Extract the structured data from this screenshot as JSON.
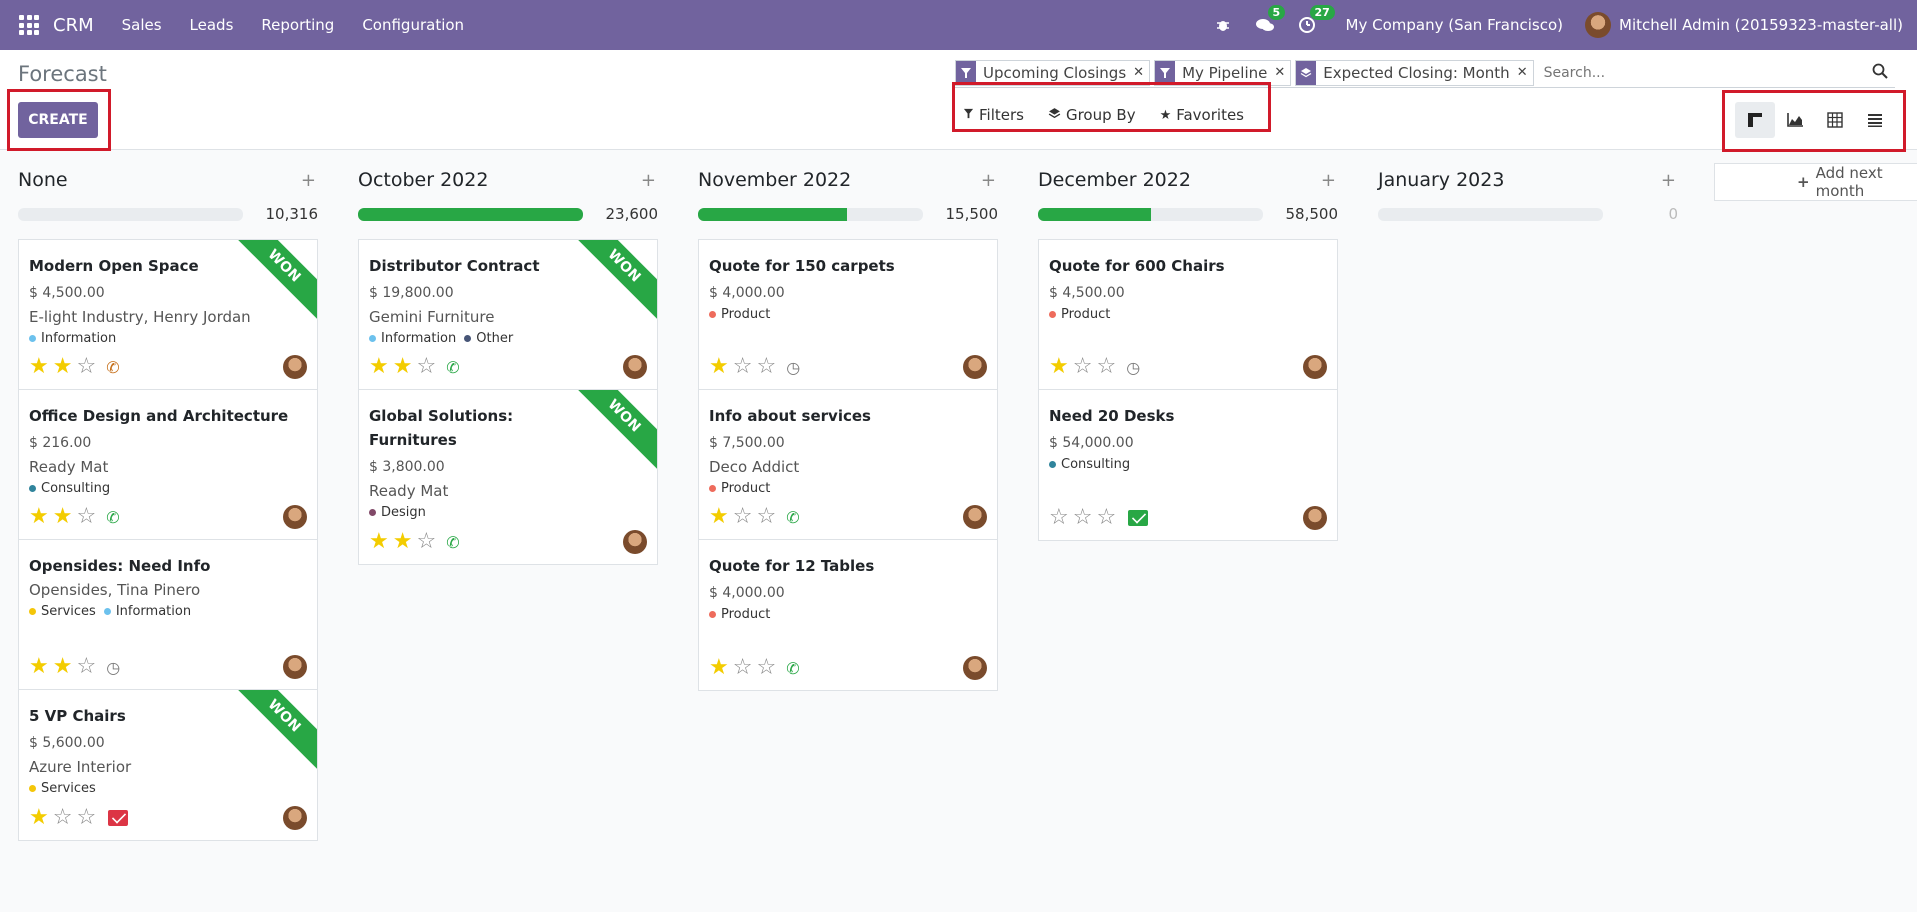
{
  "navbar": {
    "brand": "CRM",
    "menu": [
      "Sales",
      "Leads",
      "Reporting",
      "Configuration"
    ],
    "messages_count": "5",
    "activities_count": "27",
    "company": "My Company (San Francisco)",
    "user": "Mitchell Admin (20159323-master-all)",
    "bg_color": "#71639e"
  },
  "control": {
    "breadcrumb": "Forecast",
    "create_label": "CREATE",
    "facets": [
      {
        "icon": "filter-icon",
        "label": "Upcoming Closings"
      },
      {
        "icon": "filter-icon",
        "label": "My Pipeline"
      },
      {
        "icon": "layers-icon",
        "label": "Expected Closing: Month"
      }
    ],
    "search_placeholder": "Search...",
    "filters_label": "Filters",
    "groupby_label": "Group By",
    "favorites_label": "Favorites",
    "views": [
      "kanban-view-icon",
      "graph-view-icon",
      "pivot-view-icon",
      "list-view-icon"
    ],
    "active_view": "kanban-view-icon"
  },
  "kanban": {
    "add_column_label": "Add next month",
    "columns": [
      {
        "title": "None",
        "total": "10,316",
        "progress_fraction": 0,
        "cards": [
          {
            "title": "Modern Open Space",
            "amount": "$ 4,500.00",
            "partner": "E-light Industry, Henry Jordan",
            "tags": [
              {
                "name": "Information",
                "color": "#6cc1ed"
              }
            ],
            "stars": 2,
            "activity": "phone-orange",
            "won": true
          },
          {
            "title": "Office Design and Architecture",
            "amount": "$ 216.00",
            "partner": "Ready Mat",
            "tags": [
              {
                "name": "Consulting",
                "color": "#30849c"
              }
            ],
            "stars": 2,
            "activity": "phone",
            "won": false
          },
          {
            "title": "Opensides: Need Info",
            "amount": "",
            "partner": "Opensides, Tina Pinero",
            "tags": [
              {
                "name": "Services",
                "color": "#f4c609"
              },
              {
                "name": "Information",
                "color": "#6cc1ed"
              }
            ],
            "stars": 2,
            "activity": "clock",
            "won": false
          },
          {
            "title": "5 VP Chairs",
            "amount": "$ 5,600.00",
            "partner": "Azure Interior",
            "tags": [
              {
                "name": "Services",
                "color": "#f4c609"
              }
            ],
            "stars": 1,
            "activity": "mail-red",
            "won": true
          }
        ]
      },
      {
        "title": "October 2022",
        "total": "23,600",
        "progress_fraction": 1,
        "cards": [
          {
            "title": "Distributor Contract",
            "amount": "$ 19,800.00",
            "partner": "Gemini Furniture",
            "tags": [
              {
                "name": "Information",
                "color": "#6cc1ed"
              },
              {
                "name": "Other",
                "color": "#475577"
              }
            ],
            "stars": 2,
            "activity": "phone",
            "won": true
          },
          {
            "title": "Global Solutions: Furnitures",
            "amount": "$ 3,800.00",
            "partner": "Ready Mat",
            "tags": [
              {
                "name": "Design",
                "color": "#814968"
              }
            ],
            "stars": 2,
            "activity": "phone",
            "won": true
          }
        ]
      },
      {
        "title": "November 2022",
        "total": "15,500",
        "progress_fraction": 0.66,
        "cards": [
          {
            "title": "Quote for 150 carpets",
            "amount": "$ 4,000.00",
            "partner": "",
            "tags": [
              {
                "name": "Product",
                "color": "#ee6b5c"
              }
            ],
            "stars": 1,
            "activity": "clock",
            "won": false
          },
          {
            "title": "Info about services",
            "amount": "$ 7,500.00",
            "partner": "Deco Addict",
            "tags": [
              {
                "name": "Product",
                "color": "#ee6b5c"
              }
            ],
            "stars": 1,
            "activity": "phone",
            "won": false
          },
          {
            "title": "Quote for 12 Tables",
            "amount": "$ 4,000.00",
            "partner": "",
            "tags": [
              {
                "name": "Product",
                "color": "#ee6b5c"
              }
            ],
            "stars": 1,
            "activity": "phone",
            "won": false
          }
        ]
      },
      {
        "title": "December 2022",
        "total": "58,500",
        "progress_fraction": 0.5,
        "cards": [
          {
            "title": "Quote for 600 Chairs",
            "amount": "$ 4,500.00",
            "partner": "",
            "tags": [
              {
                "name": "Product",
                "color": "#ee6b5c"
              }
            ],
            "stars": 1,
            "activity": "clock",
            "won": false
          },
          {
            "title": "Need 20 Desks",
            "amount": "$ 54,000.00",
            "partner": "",
            "tags": [
              {
                "name": "Consulting",
                "color": "#30849c"
              }
            ],
            "stars": 0,
            "activity": "mail-green",
            "won": false
          }
        ]
      },
      {
        "title": "January 2023",
        "total": "0",
        "progress_fraction": 0,
        "cards": []
      }
    ],
    "won_label": "WON"
  }
}
